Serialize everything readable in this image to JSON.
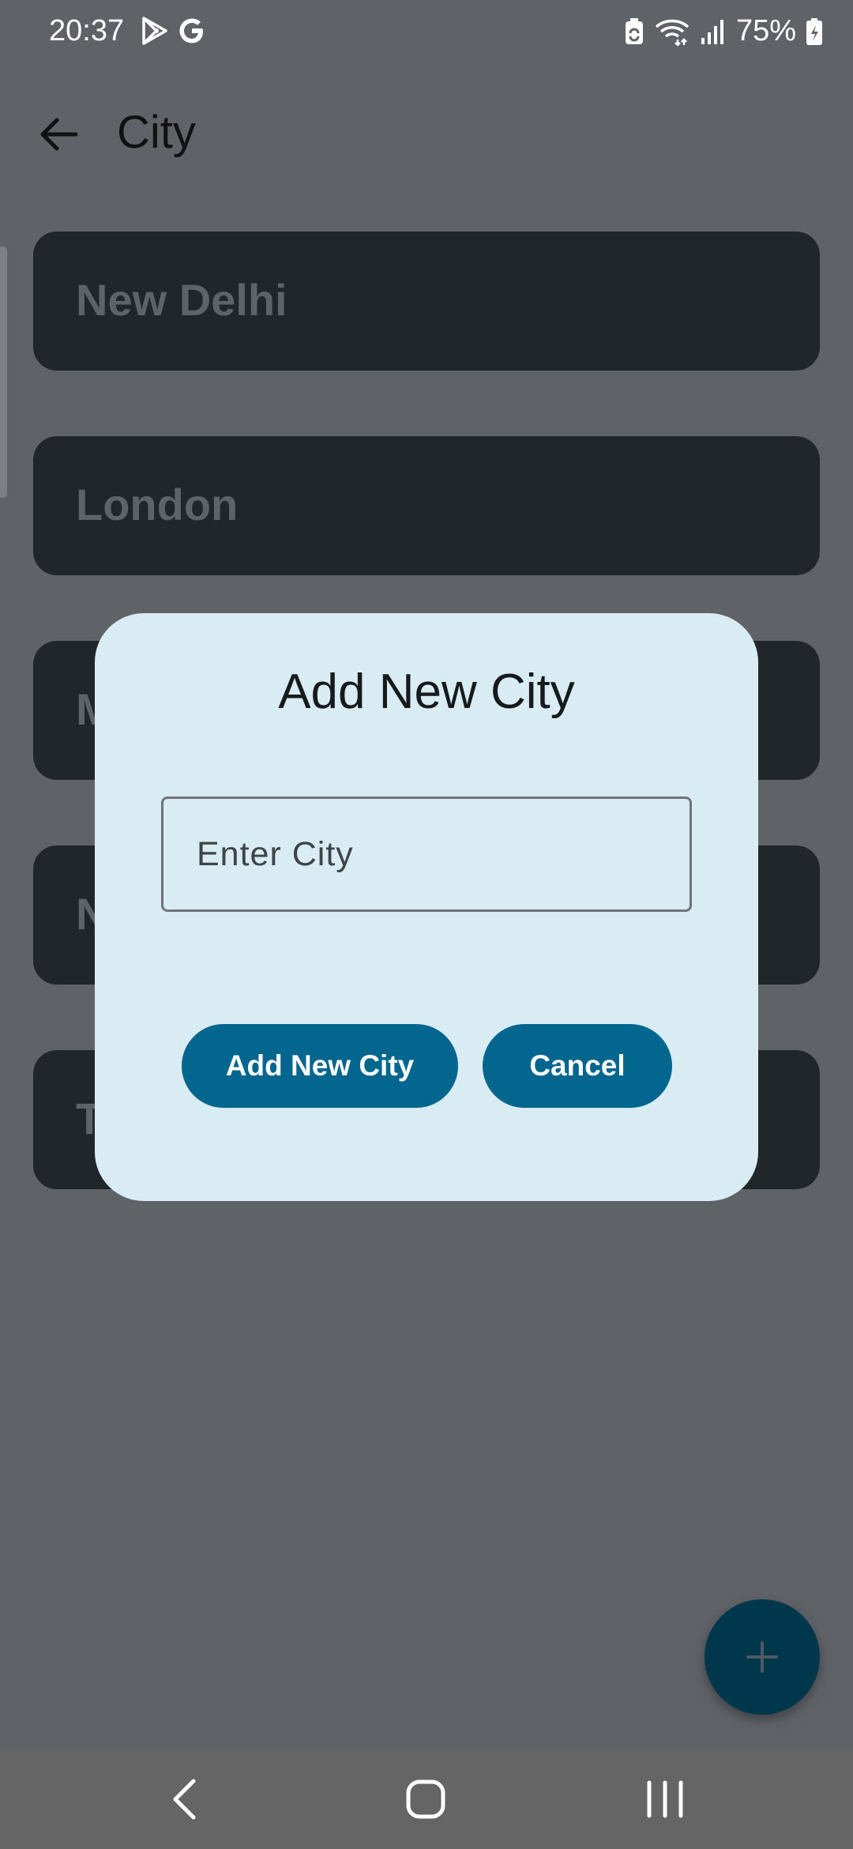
{
  "status_bar": {
    "time": "20:37",
    "battery_percent": "75%",
    "left_icons": [
      "play-store-icon",
      "google-icon"
    ],
    "right_icons": [
      "battery-saver-icon",
      "wifi-icon",
      "signal-icon",
      "battery-icon"
    ]
  },
  "app_bar": {
    "title": "City",
    "back_icon": "arrow-back-icon"
  },
  "cities": [
    {
      "label": "New Delhi"
    },
    {
      "label": "London"
    },
    {
      "label": "M"
    },
    {
      "label": "N"
    },
    {
      "label": "T"
    }
  ],
  "dialog": {
    "title": "Add New City",
    "input_placeholder": "Enter City",
    "input_value": "",
    "confirm_label": "Add New City",
    "cancel_label": "Cancel"
  },
  "fab": {
    "icon": "plus-icon"
  },
  "nav_bar": {
    "icons": [
      "nav-back-icon",
      "nav-home-icon",
      "nav-recents-icon"
    ]
  },
  "colors": {
    "scrim_background": "#5f6368",
    "card": "#202629",
    "dialog": "#d9ebf3",
    "button": "#02668f",
    "fab": "#00374d",
    "nav_bar": "#656565"
  }
}
